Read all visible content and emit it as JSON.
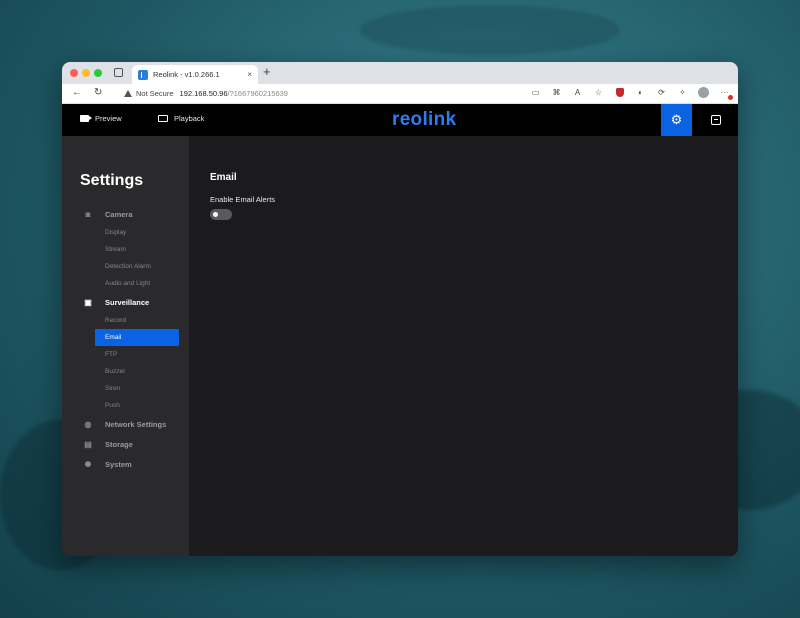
{
  "browser": {
    "tab_title": "Reolink - v1.0.266.1",
    "tab_close": "×",
    "new_tab": "+",
    "security_label": "Not Secure",
    "url_host": "192.168.50.96",
    "url_path": "/?1667960215639"
  },
  "app": {
    "nav": {
      "preview": "Preview",
      "playback": "Playback"
    },
    "logo": "reolink",
    "accent_color": "#0a63e3"
  },
  "sidebar": {
    "title": "Settings",
    "camera": {
      "label": "Camera",
      "icon": "camera-icon",
      "items": [
        "Display",
        "Stream",
        "Detection Alarm",
        "Audio and Light"
      ]
    },
    "surveillance": {
      "label": "Surveillance",
      "icon": "monitor-icon",
      "items": [
        "Record",
        "Email",
        "FTP",
        "Buzzer",
        "Siren",
        "Push"
      ],
      "selected": "Email"
    },
    "network": {
      "label": "Network Settings",
      "icon": "globe-icon"
    },
    "storage": {
      "label": "Storage",
      "icon": "storage-icon"
    },
    "system": {
      "label": "System",
      "icon": "gear-icon"
    }
  },
  "main": {
    "section_title": "Email",
    "enable_label": "Enable Email Alerts",
    "enable_value": false
  }
}
